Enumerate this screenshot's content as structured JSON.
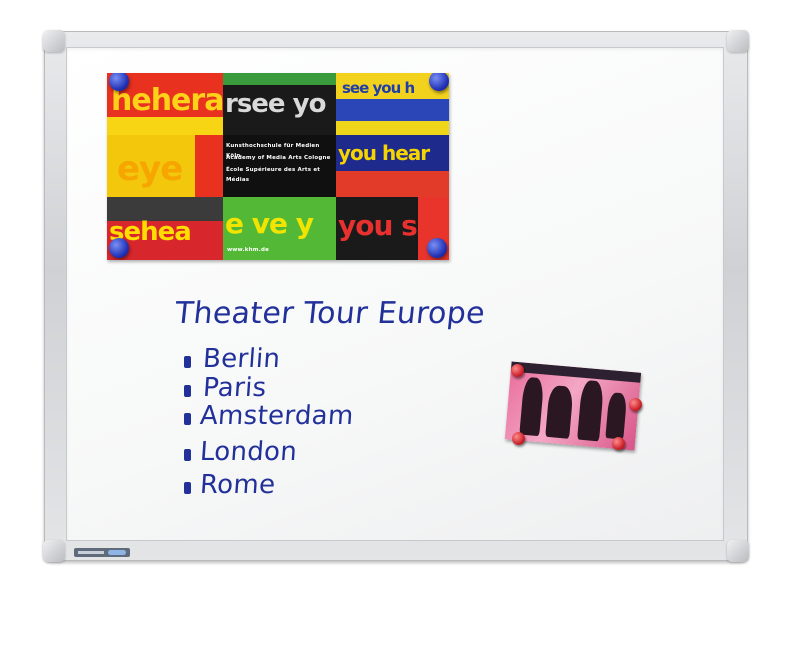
{
  "board": {
    "frame_color": "#d2d4d7",
    "surface_color": "#f6f7f7"
  },
  "poster": {
    "tiles": [
      {
        "text": "hehera",
        "bg": "#e8311f",
        "fg": "#ffd21a"
      },
      {
        "text": "rsee yo",
        "bg": "#1a1a1a",
        "fg": "#d9d9d9"
      },
      {
        "text": "see you h",
        "bg": "#f3d21e",
        "fg": "#1f3ea8"
      },
      {
        "text": "eye",
        "bg": "#f2c70c",
        "fg": "#f7a600"
      },
      {
        "text": "",
        "bg": "#101010",
        "fg": "#ffffff"
      },
      {
        "text": "you hear",
        "bg": "#1e2a8c",
        "fg": "#f5d400"
      },
      {
        "text": "sehea",
        "bg": "#d8262d",
        "fg": "#ffdd00"
      },
      {
        "text": "e ve y",
        "bg": "#52b836",
        "fg": "#f1e400"
      },
      {
        "text": "you se",
        "bg": "#1a1a1a",
        "fg": "#e8312e"
      }
    ],
    "institution_lines": [
      "Kunsthochschule für Medien Köln",
      "Academy of Media Arts Cologne",
      "École Supérieure des Arts et Médias"
    ],
    "url": "www.khm.de"
  },
  "handwriting": {
    "title": "Theater Tour Europe",
    "items": [
      "Berlin",
      "Paris",
      "Amsterdam",
      "London",
      "Rome"
    ],
    "ink_color": "#22309a"
  },
  "colors": {
    "blue_magnet": "#2536c0",
    "red_magnet": "#c81f28",
    "card_pink": "#ec7aa5"
  }
}
